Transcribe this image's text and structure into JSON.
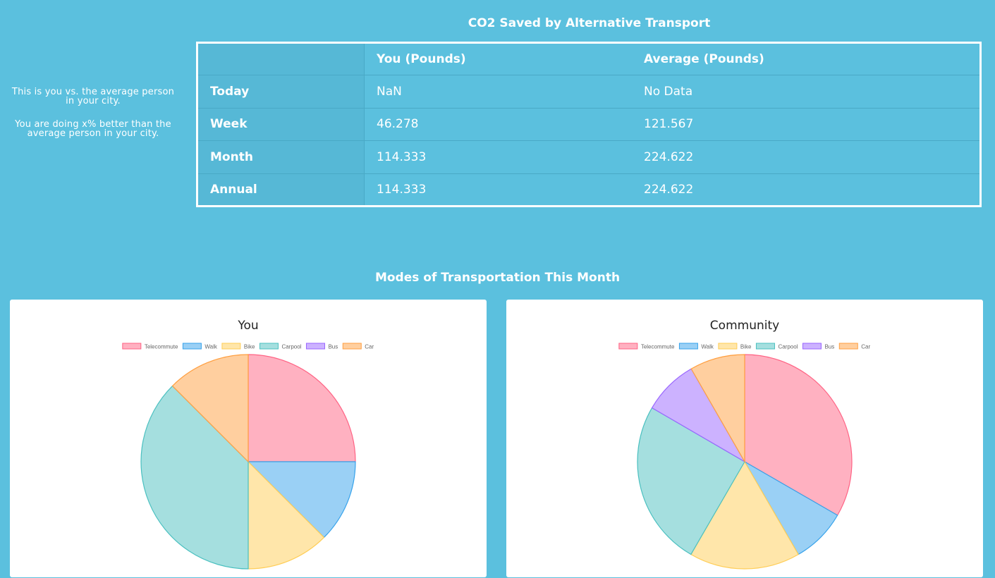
{
  "summary": {
    "line1": "This is you vs. the average person in your city.",
    "line2": "You are doing x% better than the average person in your city."
  },
  "co2_table": {
    "title": "CO2 Saved by Alternative Transport",
    "headers": [
      "",
      "You (Pounds)",
      "Average (Pounds)"
    ],
    "rows": [
      {
        "label": "Today",
        "you": "NaN",
        "average": "No Data"
      },
      {
        "label": "Week",
        "you": "46.278",
        "average": "121.567"
      },
      {
        "label": "Month",
        "you": "114.333",
        "average": "224.622"
      },
      {
        "label": "Annual",
        "you": "114.333",
        "average": "224.622"
      }
    ]
  },
  "modes_title": "Modes of Transportation This Month",
  "chart_data": [
    {
      "type": "pie",
      "title": "You",
      "legend_position": "top",
      "categories": [
        "Telecommute",
        "Walk",
        "Bike",
        "Carpool",
        "Bus",
        "Car"
      ],
      "values": [
        25,
        12.5,
        12.5,
        37.5,
        0,
        12.5
      ]
    },
    {
      "type": "pie",
      "title": "Community",
      "legend_position": "top",
      "categories": [
        "Telecommute",
        "Walk",
        "Bike",
        "Carpool",
        "Bus",
        "Car"
      ],
      "values": [
        33.3,
        8.3,
        16.7,
        25,
        8.3,
        8.3
      ]
    }
  ],
  "colors": {
    "fills": [
      "#ffb1c1",
      "#9ad0f5",
      "#ffe6aa",
      "#a5dfdf",
      "#ccb2ff",
      "#ffcf9f"
    ],
    "borders": [
      "#ff6384",
      "#36a2eb",
      "#ffcd56",
      "#4bc0c0",
      "#9966ff",
      "#ff9f40"
    ]
  }
}
